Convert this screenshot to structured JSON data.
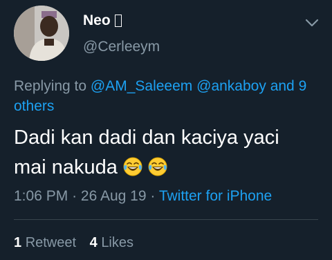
{
  "author": {
    "display_name": "Neo",
    "handle": "@Cerleeym",
    "avatar_icon": "profile-avatar"
  },
  "reply": {
    "prefix": "Replying to",
    "mentions": "@AM_Saleeem @ankaboy",
    "joiner": "and",
    "others": "9 others"
  },
  "tweet": {
    "text_line1": "Dadi kan dadi dan kaciya yaci",
    "text_line2": "mai nakuda",
    "emoji": [
      "face-with-tears-of-joy",
      "face-with-tears-of-joy"
    ]
  },
  "meta": {
    "time": "1:06 PM",
    "separator": "·",
    "date": "26 Aug 19",
    "source": "Twitter for iPhone"
  },
  "stats": {
    "retweets_count": "1",
    "retweets_label": "Retweet",
    "likes_count": "4",
    "likes_label": "Likes"
  },
  "colors": {
    "background": "#15202b",
    "text": "#ffffff",
    "secondary": "#8899a6",
    "link": "#1da1f2",
    "divider": "#38444d"
  }
}
